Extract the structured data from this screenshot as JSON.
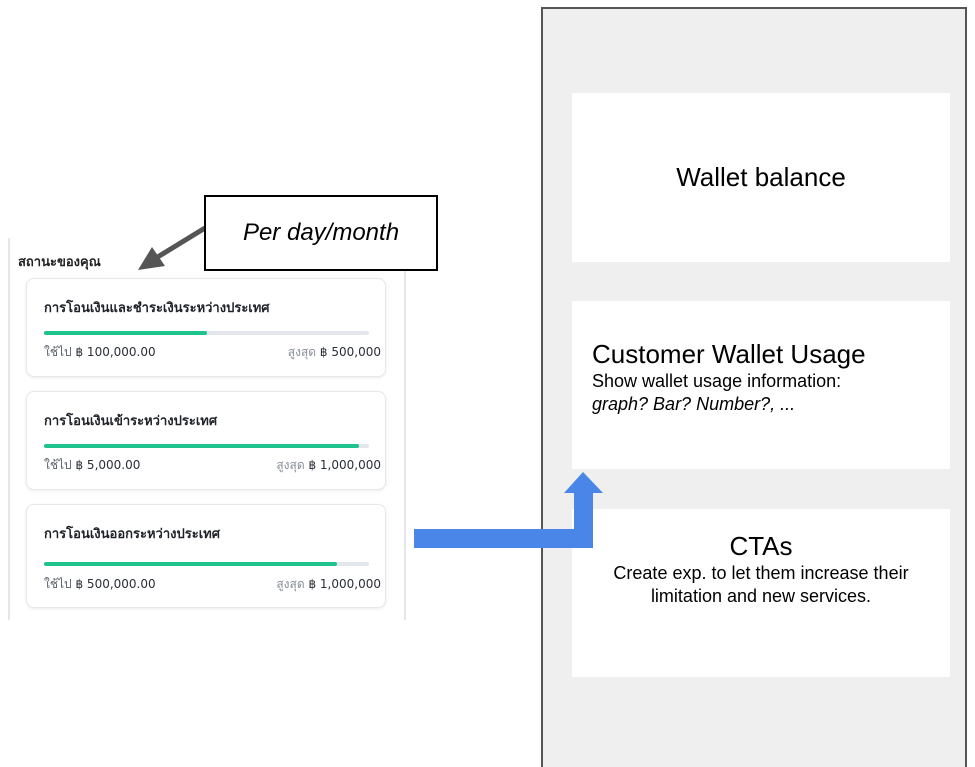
{
  "status_panel": {
    "title": "สถานะของคุณ",
    "cards": [
      {
        "title": "การโอนเงินและชำระเงินระหว่างประเทศ",
        "used_label": "ใช้ไป",
        "used_amount": "฿ 100,000.00",
        "max_label": "สูงสุด",
        "max_amount": "฿ 500,000",
        "progress": 0.5
      },
      {
        "title": "การโอนเงินเข้าระหว่างประเทศ",
        "used_label": "ใช้ไป",
        "used_amount": "฿ 5,000.00",
        "max_label": "สูงสุด",
        "max_amount": "฿ 1,000,000",
        "progress": 0.97
      },
      {
        "title": "การโอนเงินออกระหว่างประเทศ",
        "used_label": "ใช้ไป",
        "used_amount": "฿ 500,000.00",
        "max_label": "สูงสุด",
        "max_amount": "฿ 1,000,000",
        "progress": 0.9
      }
    ]
  },
  "callout": {
    "text": "Per day/month"
  },
  "wireframe": {
    "wallet_balance": {
      "heading": "Wallet balance"
    },
    "usage": {
      "heading": "Customer Wallet Usage",
      "line1": "Show wallet usage information:",
      "line2": "graph? Bar? Number?, ..."
    },
    "ctas": {
      "heading": "CTAs",
      "body": "Create exp. to let them increase their limitation and new services."
    }
  },
  "colors": {
    "progress_fill": "#1ec48c",
    "flow_arrow": "#4a86e8",
    "callout_arrow": "#555555",
    "wireframe_bg": "#efefef"
  }
}
